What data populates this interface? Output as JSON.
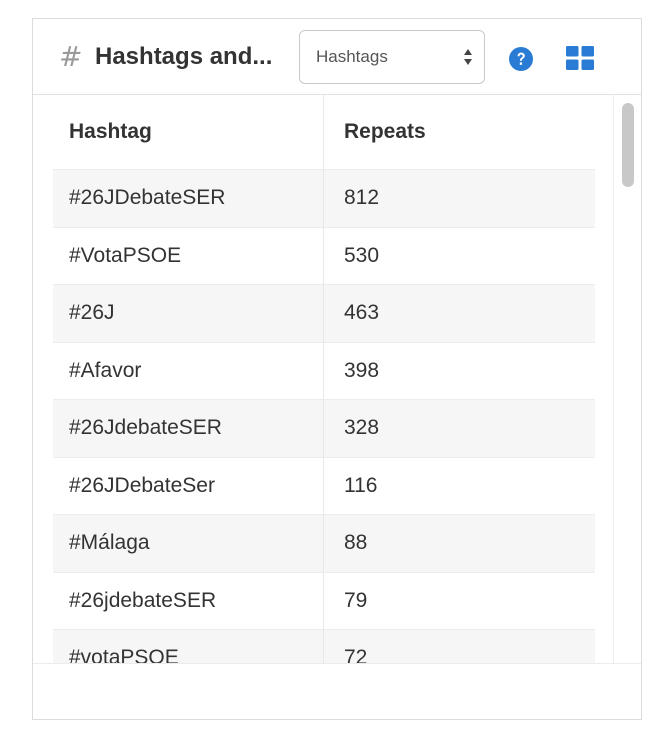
{
  "header": {
    "hash_icon_glyph": "#",
    "title": "Hashtags and...",
    "select": {
      "selected": "Hashtags"
    },
    "help_icon": "question-circle-icon",
    "grid_icon": "grid-icon",
    "accent_color": "#2a7bd3"
  },
  "table": {
    "columns": [
      "Hashtag",
      "Repeats"
    ],
    "rows": [
      {
        "hashtag": "#26JDebateSER",
        "repeats": "812"
      },
      {
        "hashtag": "#VotaPSOE",
        "repeats": "530"
      },
      {
        "hashtag": "#26J",
        "repeats": "463"
      },
      {
        "hashtag": "#Afavor",
        "repeats": "398"
      },
      {
        "hashtag": "#26JdebateSER",
        "repeats": "328"
      },
      {
        "hashtag": "#26JDebateSer",
        "repeats": "116"
      },
      {
        "hashtag": "#Málaga",
        "repeats": "88"
      },
      {
        "hashtag": "#26jdebateSER",
        "repeats": "79"
      },
      {
        "hashtag": "#votaPSOE",
        "repeats": "72"
      }
    ]
  }
}
